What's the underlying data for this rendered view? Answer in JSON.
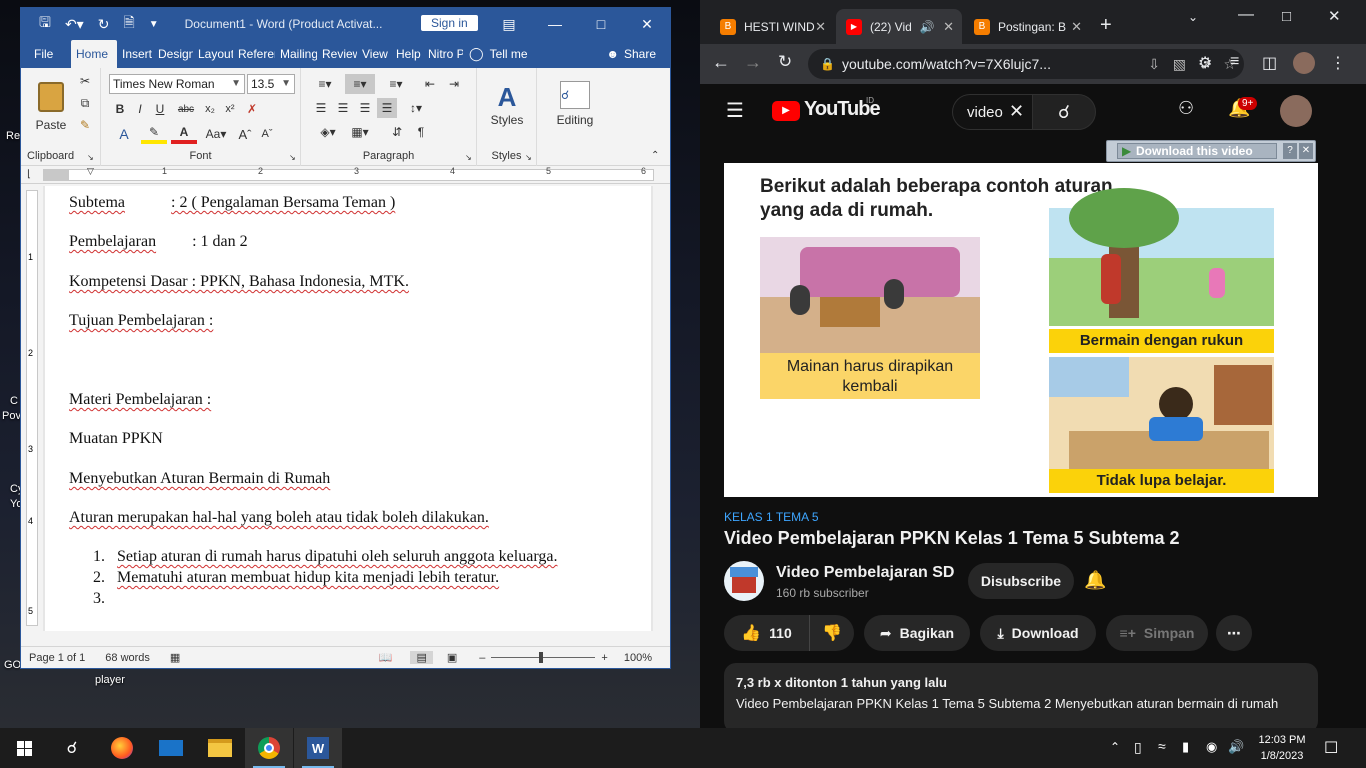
{
  "desktop": {
    "labels": [
      "Re",
      "C",
      "Pov",
      "Cy",
      "Yo",
      "GO",
      "player"
    ]
  },
  "word": {
    "title": "Document1  -  Word (Product Activat...",
    "signin": "Sign in",
    "tabs": [
      "File",
      "Home",
      "Insert",
      "Design",
      "Layout",
      "References",
      "Mailings",
      "Review",
      "View",
      "Help",
      "Nitro Pro"
    ],
    "tell_me": "Tell me",
    "share": "Share",
    "ribbon": {
      "paste": "Paste",
      "clipboard": "Clipboard",
      "font_name": "Times New Roman",
      "font_size": "13.5",
      "font_group": "Font",
      "paragraph_group": "Paragraph",
      "styles": "Styles",
      "styles_group": "Styles",
      "editing": "Editing"
    },
    "ruler_numbers": [
      "1",
      "2",
      "3",
      "4",
      "5",
      "6"
    ],
    "vruler_numbers": [
      "1",
      "2",
      "3",
      "4",
      "5"
    ],
    "document": {
      "subtema_label": "Subtema",
      "subtema_value": ": 2 ( Pengalaman Bersama Teman )",
      "pembelajaran_label": "Pembelajaran",
      "pembelajaran_value": ": 1 dan 2",
      "kompetensi": "Kompetensi Dasar : PPKN, Bahasa Indonesia,  MTK.",
      "tujuan": "Tujuan Pembelajaran :",
      "materi": "Materi Pembelajaran :",
      "muatan": "Muatan PPKN",
      "menyebutkan": "Menyebutkan Aturan Bermain di Rumah",
      "aturan": "Aturan merupakan hal-hal yang boleh atau tidak boleh dilakukan.",
      "list": [
        {
          "num": "1.",
          "text": "Setiap aturan di rumah harus dipatuhi oleh seluruh anggota keluarga."
        },
        {
          "num": "2.",
          "text": "Mematuhi aturan membuat hidup kita menjadi lebih teratur."
        },
        {
          "num": "3.",
          "text": ""
        }
      ]
    },
    "status": {
      "page": "Page 1 of 1",
      "words": "68 words",
      "zoom": "100%"
    }
  },
  "chrome": {
    "tabs": [
      {
        "title": "HESTI WIND",
        "favicon_color": "#f57d00",
        "favicon": "B"
      },
      {
        "title": "(22) Vid",
        "favicon_color": "#ff0000",
        "favicon": "▶"
      },
      {
        "title": "Postingan: B",
        "favicon_color": "#f57d00",
        "favicon": "B"
      }
    ],
    "url": "youtube.com/watch?v=7X6lujc7...",
    "youtube": {
      "logo": "YouTube",
      "region": "ID",
      "search_value": "video",
      "notif_count": "9+",
      "download_bar": "Download this video",
      "thumb_title": "Berikut adalah beberapa contoh aturan yang ada di rumah.",
      "caption1": "Mainan harus dirapikan kembali",
      "caption2": "Bermain dengan rukun",
      "caption3": "Tidak lupa belajar.",
      "hashtag": "KELAS 1 TEMA 5",
      "video_title": "Video Pembelajaran PPKN Kelas 1 Tema 5 Subtema 2",
      "channel": "Video Pembelajaran SD",
      "subs": "160 rb subscriber",
      "subscribe": "Disubscribe",
      "likes": "110",
      "share": "Bagikan",
      "download": "Download",
      "save": "Simpan",
      "views": "7,3 rb x ditonton  1 tahun yang lalu",
      "description": "Video Pembelajaran PPKN Kelas 1 Tema 5 Subtema 2 Menyebutkan aturan bermain di rumah"
    }
  },
  "taskbar": {
    "time": "12:03 PM",
    "date": "1/8/2023"
  }
}
